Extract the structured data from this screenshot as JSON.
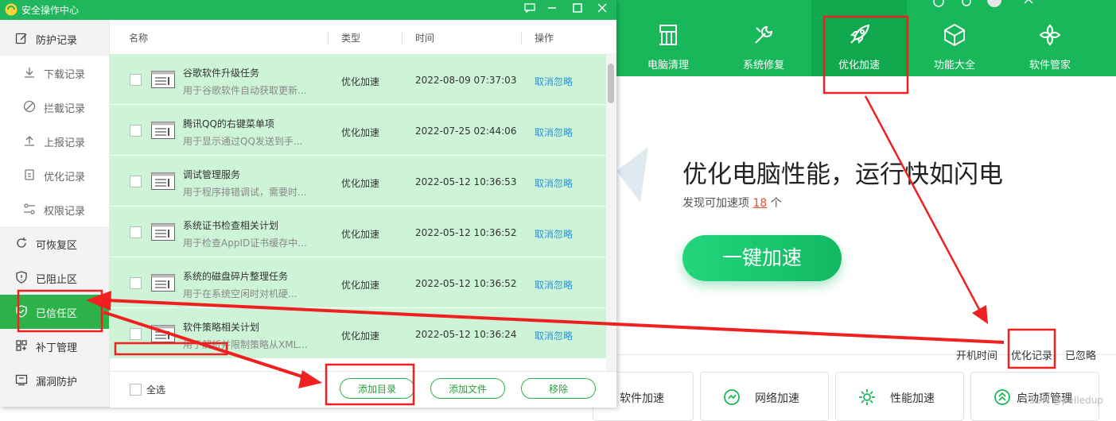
{
  "dialog": {
    "title": "安全操作中心",
    "sidebar": [
      {
        "label": "防护记录",
        "level": "top",
        "icon": "edit-icon"
      },
      {
        "label": "下载记录",
        "level": "sub",
        "icon": "download-icon"
      },
      {
        "label": "拦截记录",
        "level": "sub",
        "icon": "block-icon"
      },
      {
        "label": "上报记录",
        "level": "sub",
        "icon": "upload-icon"
      },
      {
        "label": "优化记录",
        "level": "sub",
        "icon": "optimize-record-icon"
      },
      {
        "label": "权限记录",
        "level": "sub",
        "icon": "permission-icon"
      },
      {
        "label": "可恢复区",
        "level": "top",
        "icon": "restore-icon"
      },
      {
        "label": "已阻止区",
        "level": "top",
        "icon": "shield-icon"
      },
      {
        "label": "已信任区",
        "level": "top",
        "icon": "trusted-shield-icon",
        "active": true
      },
      {
        "label": "补丁管理",
        "level": "top",
        "icon": "patch-icon"
      },
      {
        "label": "漏洞防护",
        "level": "top",
        "icon": "vulnerability-icon"
      }
    ],
    "table": {
      "headers": {
        "name": "名称",
        "type": "类型",
        "time": "时间",
        "action": "操作"
      },
      "rows": [
        {
          "name": "谷歌软件升级任务",
          "desc": "用于谷歌软件自动获取更新...",
          "type": "优化加速",
          "time": "2022-08-09 07:37:03",
          "action": "取消忽略"
        },
        {
          "name": "腾讯QQ的右键菜单项",
          "desc": "用于显示通过QQ发送到手...",
          "type": "优化加速",
          "time": "2022-07-25 02:44:06",
          "action": "取消忽略"
        },
        {
          "name": "调试管理服务",
          "desc": "用于程序排错调试，需要时...",
          "type": "优化加速",
          "time": "2022-05-12 10:36:53",
          "action": "取消忽略"
        },
        {
          "name": "系统证书检查相关计划",
          "desc": "用于检查AppID证书缓存中...",
          "type": "优化加速",
          "time": "2022-05-12 10:36:52",
          "action": "取消忽略"
        },
        {
          "name": "系统的磁盘碎片整理任务",
          "desc": "用于在系统空闲时对机硬...",
          "type": "优化加速",
          "time": "2022-05-12 10:36:52",
          "action": "取消忽略"
        },
        {
          "name": "软件策略相关计划",
          "desc": "用于解析并限制策略从XML...",
          "type": "优化加速",
          "time": "2022-05-12 10:36:24",
          "action": "取消忽略"
        }
      ]
    },
    "footer": {
      "select_all": "全选",
      "add_dir": "添加目录",
      "add_file": "添加文件",
      "remove": "移除"
    }
  },
  "main": {
    "nav": [
      {
        "label": "电脑清理",
        "icon": "broom-icon"
      },
      {
        "label": "系统修复",
        "icon": "wrench-icon"
      },
      {
        "label": "优化加速",
        "icon": "rocket-icon",
        "active": true
      },
      {
        "label": "功能大全",
        "icon": "cube-icon"
      },
      {
        "label": "软件管家",
        "icon": "app-grid-icon"
      }
    ],
    "hero": {
      "title": "优化电脑性能，运行快如闪电",
      "subtitle_prefix": "发现可加速项",
      "count": "18",
      "subtitle_suffix": "个",
      "button": "一键加速"
    },
    "links": {
      "boot_time": "开机时间",
      "opt_record": "优化记录",
      "ignored": "已忽略"
    },
    "cards": [
      {
        "label": "软件加速",
        "icon": "software-accel-icon"
      },
      {
        "label": "网络加速",
        "icon": "network-icon"
      },
      {
        "label": "性能加速",
        "icon": "gear-icon"
      },
      {
        "label": "启动项管理",
        "icon": "startup-icon"
      }
    ],
    "watermark": "CSDN @pelledup"
  },
  "colors": {
    "brand_green": "#18b85a",
    "row_green": "#cdf4d7",
    "link_blue": "#2b8fe0",
    "annotation_red": "#f02020",
    "count_red": "#e84e2e"
  }
}
